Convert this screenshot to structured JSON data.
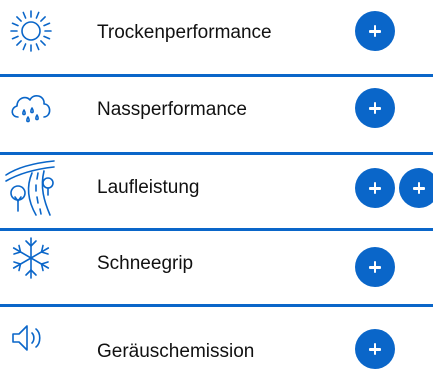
{
  "colors": {
    "accent": "#0a66c9",
    "text": "#111111",
    "background": "#ffffff"
  },
  "items": [
    {
      "label": "Trockenperformance",
      "icon": "sun-icon"
    },
    {
      "label": "Nassperformance",
      "icon": "rain-cloud-icon"
    },
    {
      "label": "Laufleistung",
      "icon": "road-icon"
    },
    {
      "label": "Schneegrip",
      "icon": "snowflake-icon"
    },
    {
      "label": "Geräuschemission",
      "icon": "speaker-icon"
    }
  ]
}
